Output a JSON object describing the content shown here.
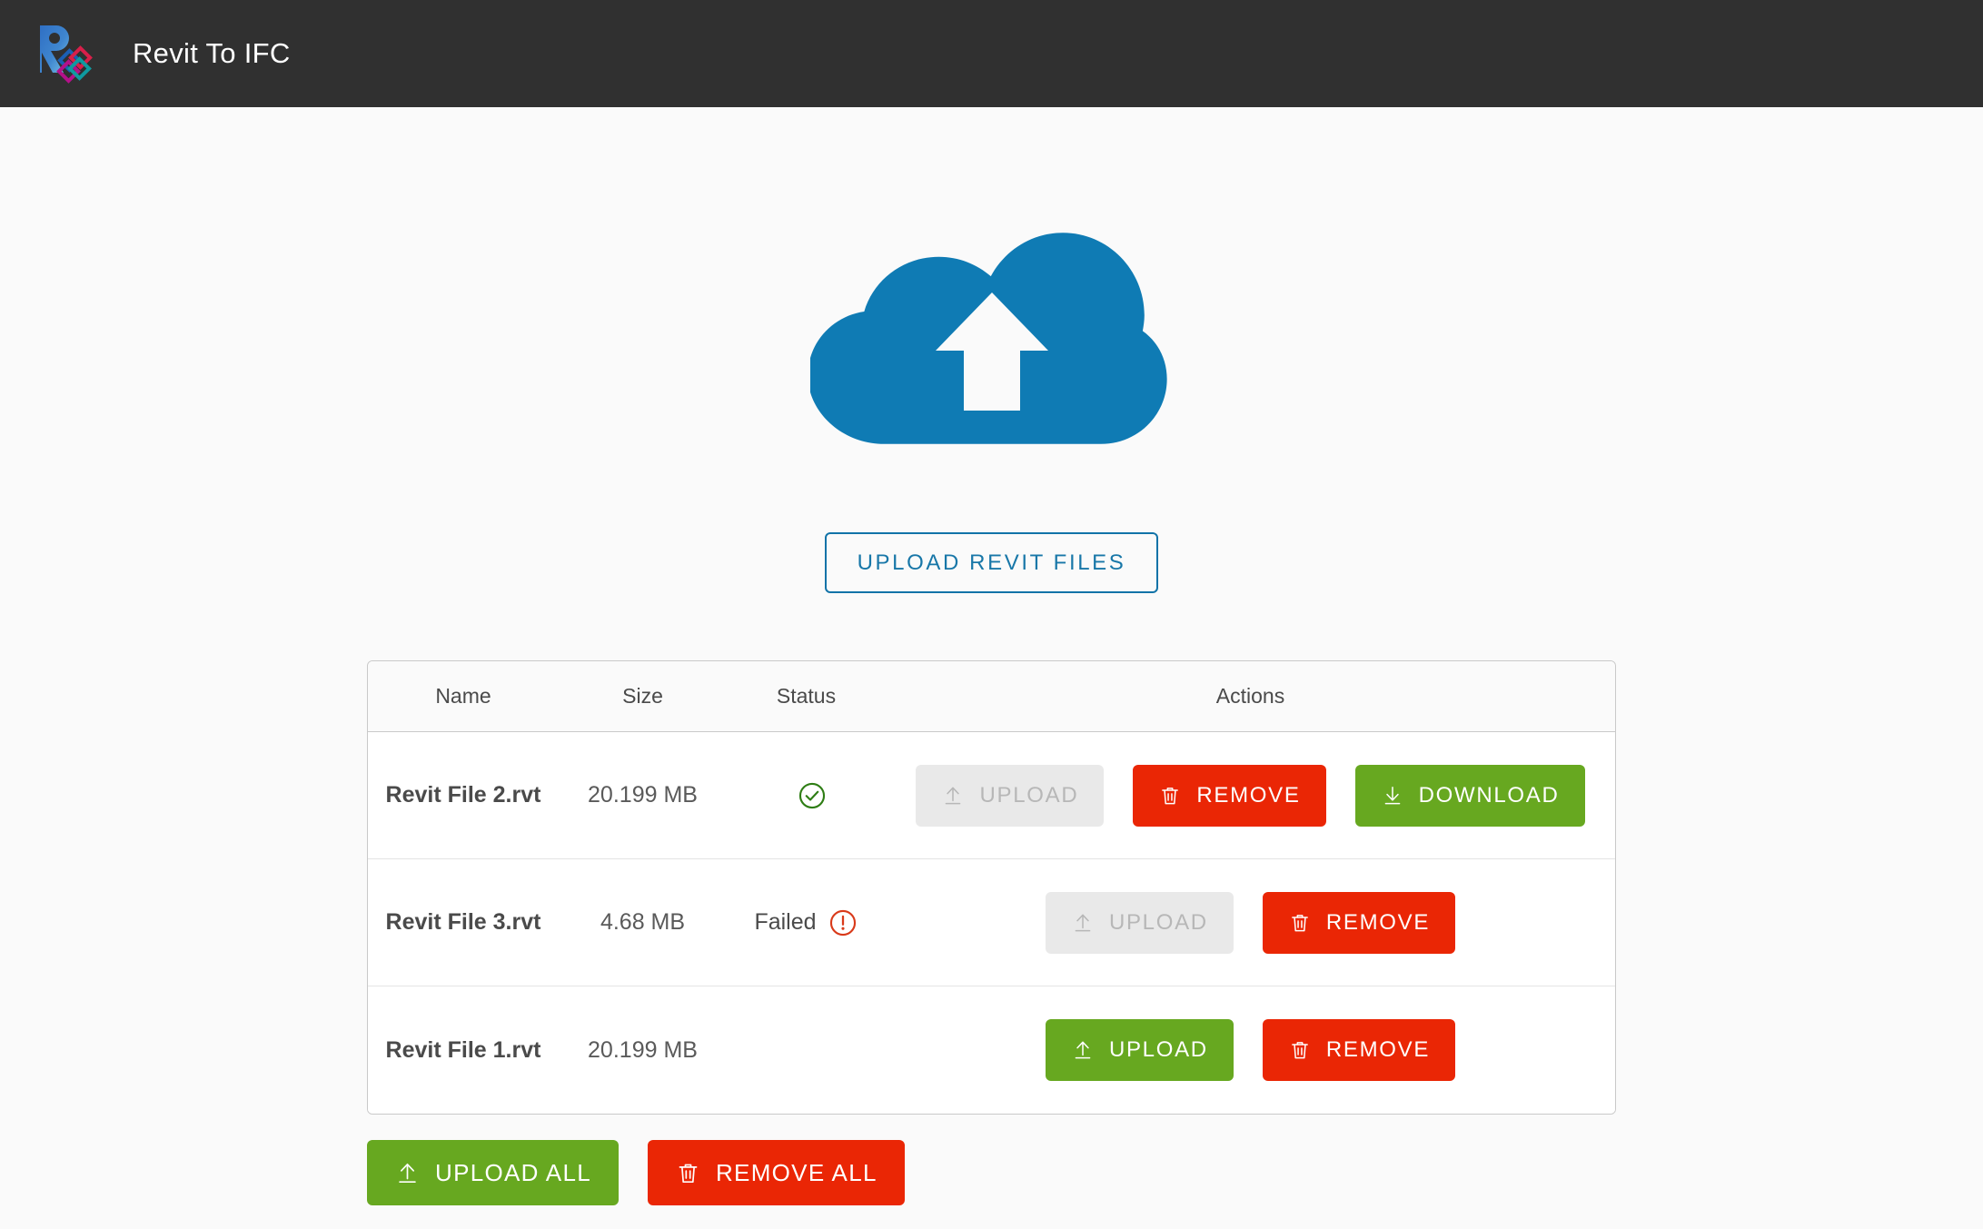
{
  "appbar": {
    "title": "Revit To IFC",
    "logo_icon": "revit-to-ifc-logo",
    "background": "#303030"
  },
  "hero": {
    "cloud_icon": "cloud-upload-icon",
    "cloud_color": "#0f7bb4",
    "upload_files_button": "UPLOAD REVIT FILES",
    "upload_files_button_color": "#1877a8"
  },
  "table": {
    "columns": [
      "Name",
      "Size",
      "Status",
      "Actions"
    ],
    "rows": [
      {
        "name": "Revit File 2.rvt",
        "size": "20.199 MB",
        "status_text": "",
        "status_icon": "check-circle-icon",
        "status_color": "#2e7d14",
        "actions": [
          {
            "label": "UPLOAD",
            "icon": "upload-arrow-icon",
            "style": "disabled"
          },
          {
            "label": "REMOVE",
            "icon": "trash-icon",
            "style": "red"
          },
          {
            "label": "DOWNLOAD",
            "icon": "download-arrow-icon",
            "style": "green"
          }
        ]
      },
      {
        "name": "Revit File 3.rvt",
        "size": "4.68 MB",
        "status_text": "Failed",
        "status_icon": "error-circle-icon",
        "status_color": "#d93a1a",
        "actions": [
          {
            "label": "UPLOAD",
            "icon": "upload-arrow-icon",
            "style": "disabled"
          },
          {
            "label": "REMOVE",
            "icon": "trash-icon",
            "style": "red"
          }
        ]
      },
      {
        "name": "Revit File 1.rvt",
        "size": "20.199 MB",
        "status_text": "",
        "status_icon": "",
        "status_color": "",
        "actions": [
          {
            "label": "UPLOAD",
            "icon": "upload-arrow-icon",
            "style": "green"
          },
          {
            "label": "REMOVE",
            "icon": "trash-icon",
            "style": "red"
          }
        ]
      }
    ]
  },
  "bulk_actions": {
    "upload_all": "UPLOAD ALL",
    "upload_all_icon": "upload-arrow-icon",
    "remove_all": "REMOVE ALL",
    "remove_all_icon": "trash-icon",
    "green": "#67a820",
    "red": "#ea2605"
  }
}
